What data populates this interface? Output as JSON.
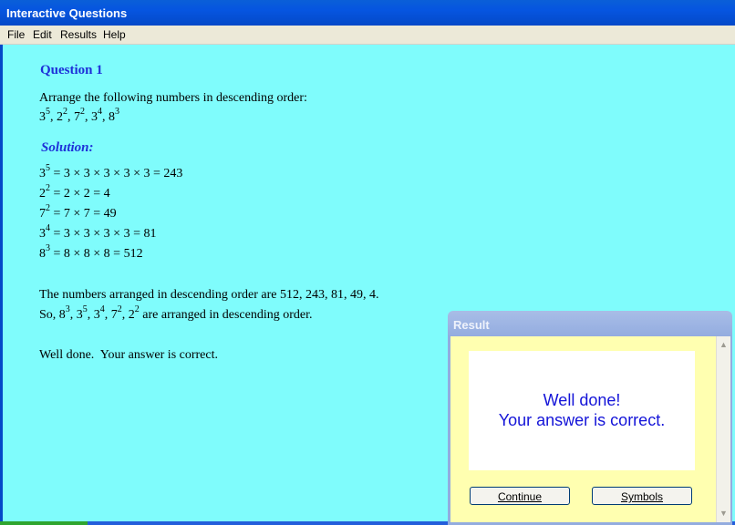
{
  "window": {
    "title": "Interactive Questions"
  },
  "menu": [
    "File",
    "Edit",
    "Results",
    "Help"
  ],
  "question": {
    "heading": "Question 1",
    "prompt": "Arrange the following numbers in descending order:",
    "numbers": [
      {
        "base": "3",
        "exp": "5"
      },
      {
        "base": "2",
        "exp": "2"
      },
      {
        "base": "7",
        "exp": "2"
      },
      {
        "base": "3",
        "exp": "4"
      },
      {
        "base": "8",
        "exp": "3"
      }
    ]
  },
  "solution": {
    "heading": "Solution:",
    "steps": [
      {
        "base": "3",
        "exp": "5",
        "rhs": " = 3 × 3 × 3 × 3 × 3 = 243"
      },
      {
        "base": "2",
        "exp": "2",
        "rhs": " = 2 × 2 = 4"
      },
      {
        "base": "7",
        "exp": "2",
        "rhs": " = 7 × 7 = 49"
      },
      {
        "base": "3",
        "exp": "4",
        "rhs": " = 3 × 3 × 3 × 3 = 81"
      },
      {
        "base": "8",
        "exp": "3",
        "rhs": " = 8 × 8 × 8 = 512"
      }
    ],
    "summary_line": "The numbers arranged in descending order are 512, 243, 81, 49, 4.",
    "so_prefix": "So, ",
    "so_numbers": [
      {
        "base": "8",
        "exp": "3"
      },
      {
        "base": "3",
        "exp": "5"
      },
      {
        "base": "3",
        "exp": "4"
      },
      {
        "base": "7",
        "exp": "2"
      },
      {
        "base": "2",
        "exp": "2"
      }
    ],
    "so_suffix": " are arranged in descending order.",
    "feedback": "Well done.  Your answer is correct."
  },
  "result_dialog": {
    "title": "Result",
    "message_line1": "Well done!",
    "message_line2": "Your answer is correct.",
    "continue_label": "Continue",
    "symbols_label": "Symbols",
    "scroll_up": "▲",
    "scroll_down": "▼"
  }
}
